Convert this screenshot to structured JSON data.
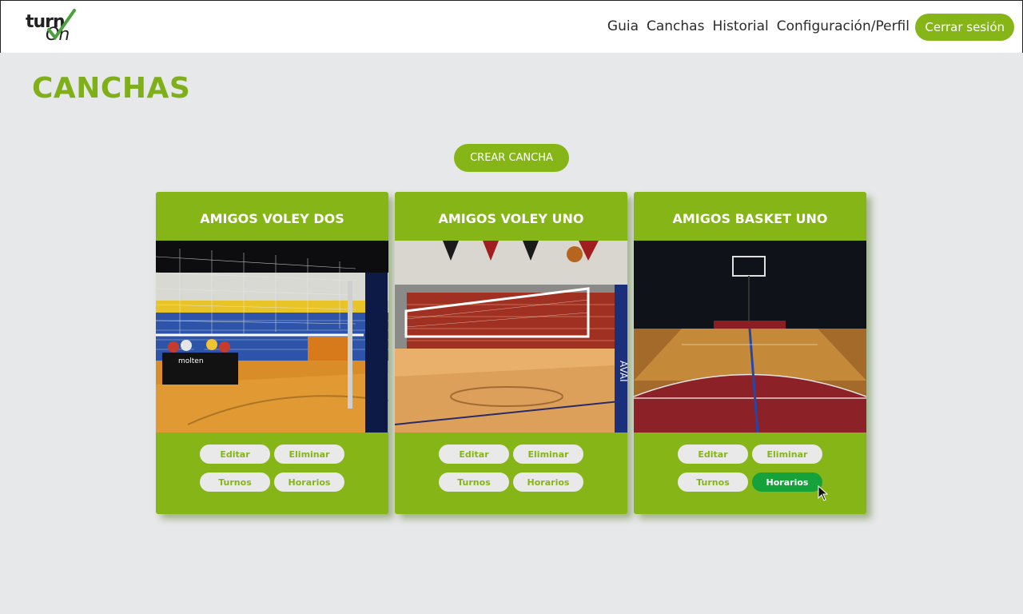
{
  "app": {
    "logo_text_top": "turn",
    "logo_text_bottom": "On"
  },
  "nav": {
    "links": [
      "Guia",
      "Canchas",
      "Historial",
      "Configuración/Perfil"
    ],
    "logout_label": "Cerrar sesión"
  },
  "page": {
    "title": "CANCHAS",
    "create_button": "CREAR CANCHA"
  },
  "cards": [
    {
      "title": "AMIGOS VOLEY DOS",
      "edit": "Editar",
      "delete": "Eliminar",
      "turnos": "Turnos",
      "horarios": "Horarios",
      "image": "volleyball-court-photo"
    },
    {
      "title": "AMIGOS VOLEY UNO",
      "edit": "Editar",
      "delete": "Eliminar",
      "turnos": "Turnos",
      "horarios": "Horarios",
      "image": "volleyball-net-photo"
    },
    {
      "title": "AMIGOS BASKET UNO",
      "edit": "Editar",
      "delete": "Eliminar",
      "turnos": "Turnos",
      "horarios": "Horarios",
      "image": "basketball-court-photo"
    }
  ],
  "colors": {
    "brand_green": "#86b517",
    "title_green": "#7fb01a",
    "hover_green": "#16a23a",
    "background": "#e7e8ea"
  }
}
